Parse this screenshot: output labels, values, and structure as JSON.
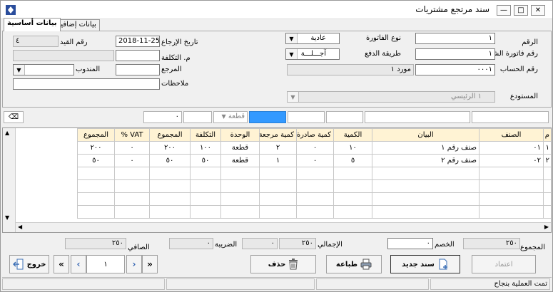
{
  "window": {
    "title": "سند مرتجع مشتريات"
  },
  "tabs": [
    {
      "label": "بيانات أساسية"
    },
    {
      "label": "بيانات إضافية"
    }
  ],
  "header": {
    "number_label": "الرقم",
    "number_value": "١",
    "purchase_invoice_label": "رقم فاتورة الشراء",
    "purchase_invoice_value": "١",
    "account_label": "رقم الحساب",
    "account_value": "٠٠٠١",
    "supplier_name": "مورد ١",
    "invoice_type_label": "نوع الفاتورة",
    "invoice_type_value": "عادية",
    "payment_label": "طريقة الدفع",
    "payment_value": "آجـــلـــة",
    "return_date_label": "تاريخ الإرجاع",
    "return_date_value": "2018-11-25",
    "entry_number_label": "رقم القيد",
    "entry_number_value": "٤",
    "cost_center_label": "م. التكلفة",
    "reference_label": "المرجع",
    "delegate_label": "المندوب",
    "notes_label": "ملاحظات",
    "warehouse_label": "المستودع",
    "warehouse_code": "١",
    "warehouse_value": "الرئيسي"
  },
  "filter": {
    "unit_value": "قطعة",
    "qty_value": "٠"
  },
  "grid": {
    "columns": [
      "م",
      "الصنف",
      "البيان",
      "الكمية",
      "كمية صادرة",
      "كمية مرجعة",
      "الوحدة",
      "التكلفة",
      "المجموع",
      "VAT %",
      "المجموع"
    ],
    "rows": [
      [
        "١",
        "٠١",
        "صنف رقم ١",
        "١٠",
        "٠",
        "٢",
        "قطعة",
        "١٠٠",
        "٢٠٠",
        "٠",
        "٢٠٠"
      ],
      [
        "٢",
        "٠٢",
        "صنف رقم ٢",
        "٥",
        "٠",
        "١",
        "قطعة",
        "٥٠",
        "٥٠",
        "٠",
        "٥٠"
      ]
    ]
  },
  "totals": {
    "sum_label": "المجموع",
    "sum_value": "٢٥٠",
    "discount_label": "الخصم",
    "discount_value": "٠",
    "gross_label": "الإجمالي",
    "gross_value": "٢٥٠",
    "extra_value": "٠",
    "tax_label": "الضريبة",
    "tax_value": "٠",
    "net_label": "الصافي",
    "net_value": "٢٥٠"
  },
  "toolbar": {
    "approve_label": "اعتماد",
    "new_label": "سند جديد",
    "print_label": "طباعة",
    "delete_label": "حذف",
    "exit_label": "خروج",
    "page_value": "١"
  },
  "status": {
    "message": "تمت العملية بنجاح"
  },
  "colors": {
    "grid_header": "#fff3d4",
    "accent": "#3399ff"
  }
}
